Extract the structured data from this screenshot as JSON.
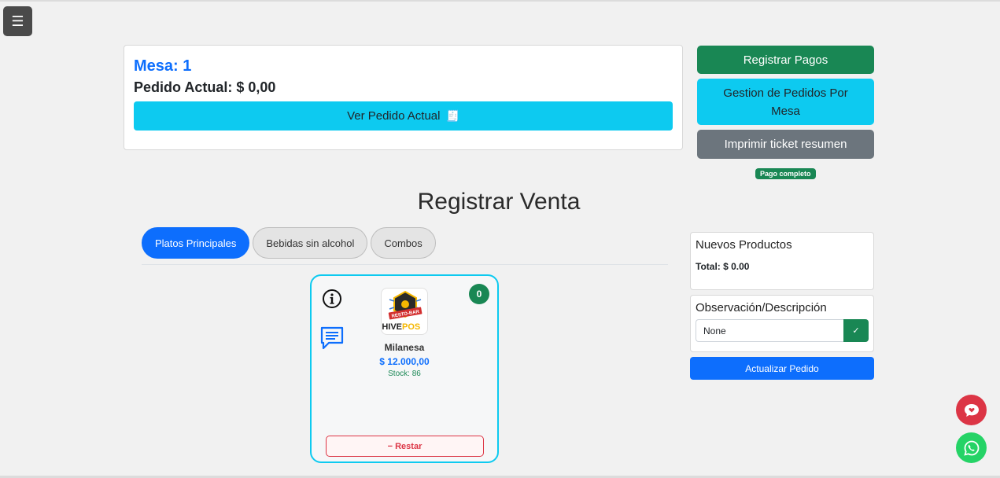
{
  "menu": {
    "icon": "hamburger-icon",
    "glyph": "☰"
  },
  "mesa": {
    "title": "Mesa: 1",
    "pedido_actual": "Pedido Actual: $ 0,00",
    "ver_pedido_label": "Ver Pedido Actual",
    "ver_pedido_icon": "🧾"
  },
  "actions": {
    "registrar_pagos": "Registrar Pagos",
    "gestion_pedidos": "Gestion de Pedidos Por Mesa",
    "imprimir_ticket": "Imprimir ticket resumen",
    "pago_badge": "Pago completo"
  },
  "venta": {
    "title": "Registrar Venta",
    "tabs": [
      {
        "label": "Platos Principales",
        "active": true
      },
      {
        "label": "Bebidas sin alcohol",
        "active": false
      },
      {
        "label": "Combos",
        "active": false
      }
    ]
  },
  "product": {
    "name": "Milanesa",
    "price": "$ 12.000,00",
    "stock": "Stock: 86",
    "count": "0",
    "restar_label": "− Restar",
    "logo_top_text": "RESTO-BAR",
    "logo_bottom_text_a": "HIVE",
    "logo_bottom_text_b": "POS"
  },
  "nuevos": {
    "title": "Nuevos Productos",
    "total": "Total: $ 0.00"
  },
  "observacion": {
    "title": "Observación/Descripción",
    "value": "None",
    "check_glyph": "✓"
  },
  "actualizar_label": "Actualizar Pedido",
  "colors": {
    "primary": "#0d6efd",
    "info": "#0dcaf0",
    "success": "#198754",
    "secondary": "#6c757d",
    "danger": "#dc3545",
    "whatsapp": "#25d366"
  }
}
